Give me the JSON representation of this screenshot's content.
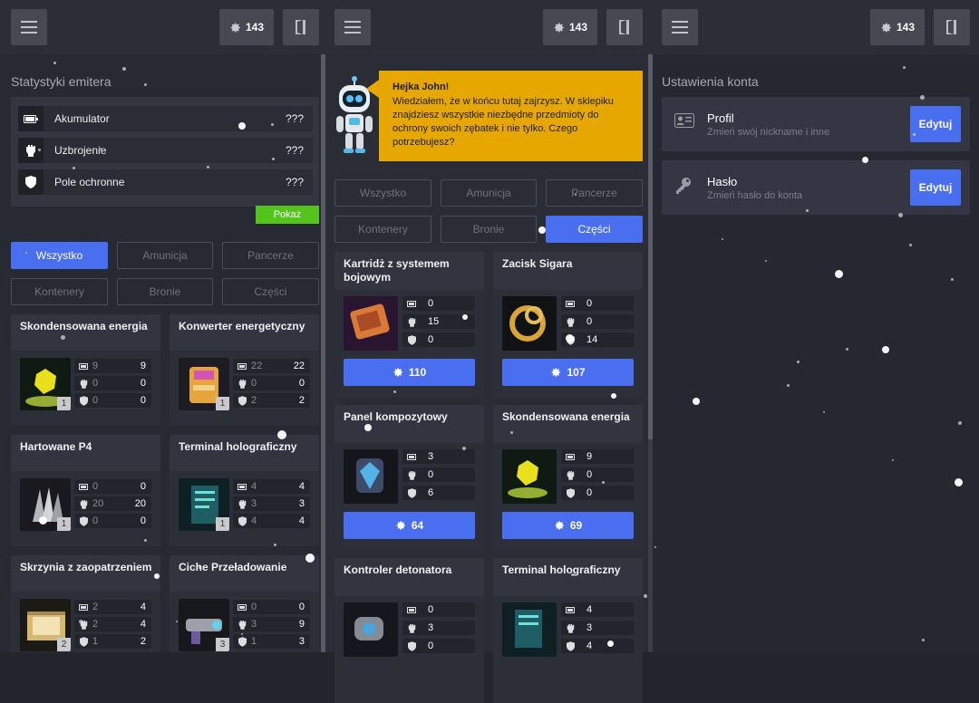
{
  "topbar": {
    "coins": "143"
  },
  "left": {
    "section_title": "Statystyki emitera",
    "stats": [
      {
        "label": "Akumulator",
        "value": "???",
        "icon": "battery-icon"
      },
      {
        "label": "Uzbrojenie",
        "value": "???",
        "icon": "fist-icon"
      },
      {
        "label": "Pole ochronne",
        "value": "???",
        "icon": "shield-icon"
      }
    ],
    "show_button": "Pokaż",
    "tabs": [
      "Wszystko",
      "Amunicja",
      "Pancerze",
      "Kontenery",
      "Bronie",
      "Części"
    ],
    "active_tab": "Wszystko",
    "items": [
      {
        "name": "Skondensowana energia",
        "qty": "1",
        "stats": [
          [
            "9",
            "9"
          ],
          [
            "0",
            "0"
          ],
          [
            "0",
            "0"
          ]
        ]
      },
      {
        "name": "Konwerter energetyczny",
        "qty": "1",
        "stats": [
          [
            "22",
            "22"
          ],
          [
            "0",
            "0"
          ],
          [
            "2",
            "2"
          ]
        ]
      },
      {
        "name": "Hartowane P4",
        "qty": "1",
        "stats": [
          [
            "0",
            "0"
          ],
          [
            "20",
            "20"
          ],
          [
            "0",
            "0"
          ]
        ]
      },
      {
        "name": "Terminal holograficzny",
        "qty": "1",
        "stats": [
          [
            "4",
            "4"
          ],
          [
            "3",
            "3"
          ],
          [
            "4",
            "4"
          ]
        ]
      },
      {
        "name": "Skrzynia z zaopatrzeniem",
        "qty": "2",
        "stats": [
          [
            "2",
            "4"
          ],
          [
            "2",
            "4"
          ],
          [
            "1",
            "2"
          ]
        ]
      },
      {
        "name": "Ciche Przeładowanie",
        "qty": "3",
        "stats": [
          [
            "0",
            "0"
          ],
          [
            "3",
            "9"
          ],
          [
            "1",
            "3"
          ]
        ]
      }
    ]
  },
  "shop": {
    "greeting_title": "Hejka John!",
    "greeting_text": "Wiedziałem, że w końcu tutaj zajrzysz. W sklepiku znajdziesz wszystkie niezbędne przedmioty do ochrony swoich zębatek i nie tylko. Czego potrzebujesz?",
    "tabs": [
      "Wszystko",
      "Amunicja",
      "Pancerze",
      "Kontenery",
      "Bronie",
      "Części"
    ],
    "active_tab": "Części",
    "items": [
      {
        "name": "Kartridż z systemem bojowym",
        "stats": [
          "0",
          "15",
          "0"
        ],
        "price": "110"
      },
      {
        "name": "Zacisk Sigara",
        "stats": [
          "0",
          "0",
          "14"
        ],
        "price": "107"
      },
      {
        "name": "Panel kompozytowy",
        "stats": [
          "3",
          "0",
          "6"
        ],
        "price": "64"
      },
      {
        "name": "Skondensowana energia",
        "stats": [
          "9",
          "0",
          "0"
        ],
        "price": "69"
      },
      {
        "name": "Kontroler detonatora",
        "stats": [
          "0",
          "3",
          "0"
        ],
        "price": ""
      },
      {
        "name": "Terminal holograficzny",
        "stats": [
          "4",
          "3",
          "4"
        ],
        "price": ""
      }
    ]
  },
  "account": {
    "section_title": "Ustawienia konta",
    "cards": [
      {
        "title": "Profil",
        "subtitle": "Zmień swój nickname i inne",
        "button": "Edytuj",
        "icon": "id-card-icon"
      },
      {
        "title": "Hasło",
        "subtitle": "Zmień hasło do konta",
        "button": "Edytuj",
        "icon": "key-icon"
      }
    ]
  },
  "colors": {
    "accent": "#4a6ef0",
    "success": "#52c41a",
    "speech": "#e6a800"
  }
}
